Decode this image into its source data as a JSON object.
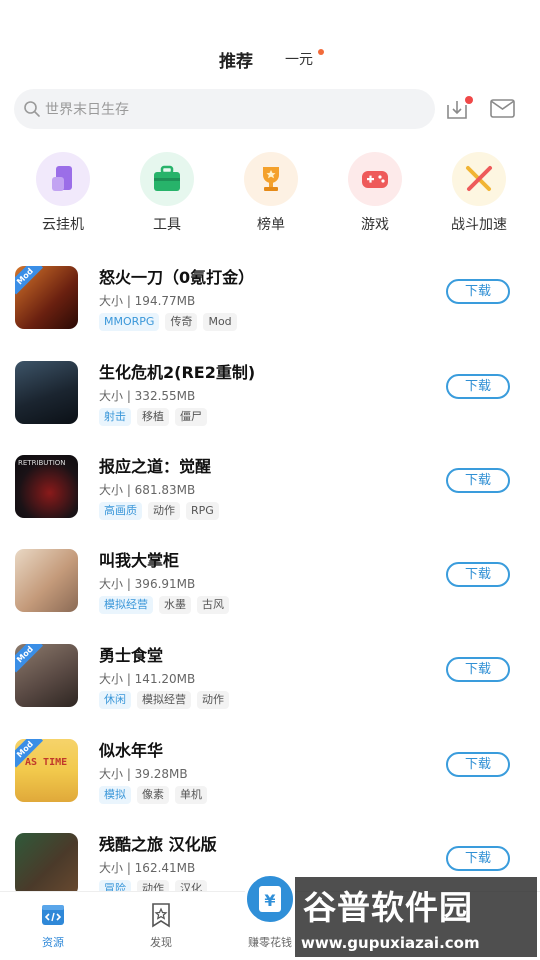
{
  "header": {
    "tab_active": "推荐",
    "tab_other": "一元"
  },
  "search": {
    "placeholder": "世界末日生存"
  },
  "categories": [
    {
      "label": "云挂机",
      "icon": "cloud-phone-icon",
      "bg": "#f1e9fb",
      "color": "#9b6ee8"
    },
    {
      "label": "工具",
      "icon": "toolbox-icon",
      "bg": "#e6f7ee",
      "color": "#27b36a"
    },
    {
      "label": "榜单",
      "icon": "trophy-icon",
      "bg": "#fdf1e3",
      "color": "#f4a12c"
    },
    {
      "label": "游戏",
      "icon": "gamepad-icon",
      "bg": "#fdeaea",
      "color": "#ee5a5a"
    },
    {
      "label": "战斗加速",
      "icon": "crossed-swords-icon",
      "bg": "#fdf6e1",
      "color": "#f1b433"
    }
  ],
  "games": [
    {
      "title": "怒火一刀（0氪打金）",
      "size": "大小 | 194.77MB",
      "tags": [
        "MMORPG",
        "传奇",
        "Mod"
      ],
      "mod": true,
      "thumb": "#8a3a1a"
    },
    {
      "title": "生化危机2(RE2重制)",
      "size": "大小 | 332.55MB",
      "tags": [
        "射击",
        "移植",
        "僵尸"
      ],
      "mod": false,
      "thumb": "#2b3a4a"
    },
    {
      "title": "报应之道：觉醒",
      "size": "大小 | 681.83MB",
      "tags": [
        "高画质",
        "动作",
        "RPG"
      ],
      "mod": false,
      "thumb": "#141418",
      "thumb_text": "RETRIBUTION"
    },
    {
      "title": "叫我大掌柜",
      "size": "大小 | 396.91MB",
      "tags": [
        "模拟经营",
        "水墨",
        "古风"
      ],
      "mod": false,
      "thumb": "#c7a88a"
    },
    {
      "title": "勇士食堂",
      "size": "大小 | 141.20MB",
      "tags": [
        "休闲",
        "模拟经营",
        "动作"
      ],
      "mod": true,
      "thumb": "#6a5a52"
    },
    {
      "title": "似水年华",
      "size": "大小 | 39.28MB",
      "tags": [
        "模拟",
        "像素",
        "单机"
      ],
      "mod": true,
      "thumb": "#f2c94c",
      "thumb_text": "AS TIME"
    },
    {
      "title": "残酷之旅  汉化版",
      "size": "大小 | 162.41MB",
      "tags": [
        "冒险",
        "动作",
        "汉化"
      ],
      "mod": false,
      "thumb": "#3a4a36"
    }
  ],
  "download_label": "下载",
  "bottom_nav": {
    "resources": "资源",
    "discover": "发现",
    "earn": "赚零花钱"
  },
  "watermark": {
    "title": "谷普软件园",
    "url": "www.gupuxiazai.com"
  },
  "colors": {
    "accent": "#2f8fd4",
    "dot": "#f26b3a"
  }
}
